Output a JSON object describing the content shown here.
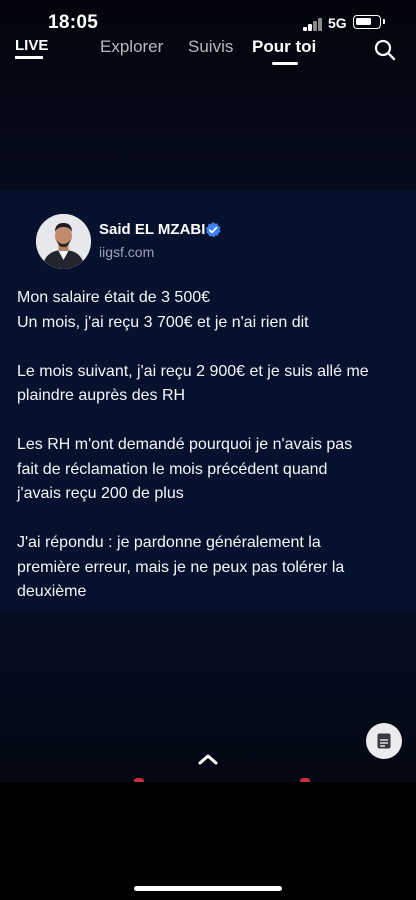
{
  "status_bar": {
    "time": "18:05",
    "network": "5G",
    "signal_icon": "cellular-signal-icon",
    "battery_icon": "battery-icon"
  },
  "top_nav": {
    "live_label": "LIVE",
    "tabs": [
      {
        "label": "Explorer",
        "active": false
      },
      {
        "label": "Suivis",
        "active": false
      },
      {
        "label": "Pour toi",
        "active": true
      }
    ],
    "search_icon": "search-icon"
  },
  "post": {
    "author_name": "Said EL MZABI",
    "verified_icon": "verified-badge-icon",
    "verified_color": "#3b82f6",
    "domain": "iigsf.com",
    "paragraphs": [
      {
        "lines": [
          "Mon salaire était de 3 500€",
          "Un mois, j'ai reçu 3 700€ et je n'ai rien dit"
        ]
      },
      {
        "lines": [
          "Le mois suivant, j'ai reçu 2 900€ et je suis allé me",
          "plaindre auprès des RH"
        ]
      },
      {
        "lines": [
          "Les RH m'ont demandé pourquoi je n'avais pas",
          "fait de réclamation le mois précédent quand",
          "j'avais reçu 200 de plus"
        ]
      },
      {
        "lines": [
          "J'ai répondu : je pardonne généralement la",
          "première erreur, mais je ne peux pas tolérer la",
          "deuxième"
        ]
      }
    ]
  },
  "controls": {
    "doc_icon": "document-icon",
    "chevron_icon": "chevron-up-icon"
  },
  "colors": {
    "card_background": "#06122d",
    "accent_red": "#c2303a"
  }
}
